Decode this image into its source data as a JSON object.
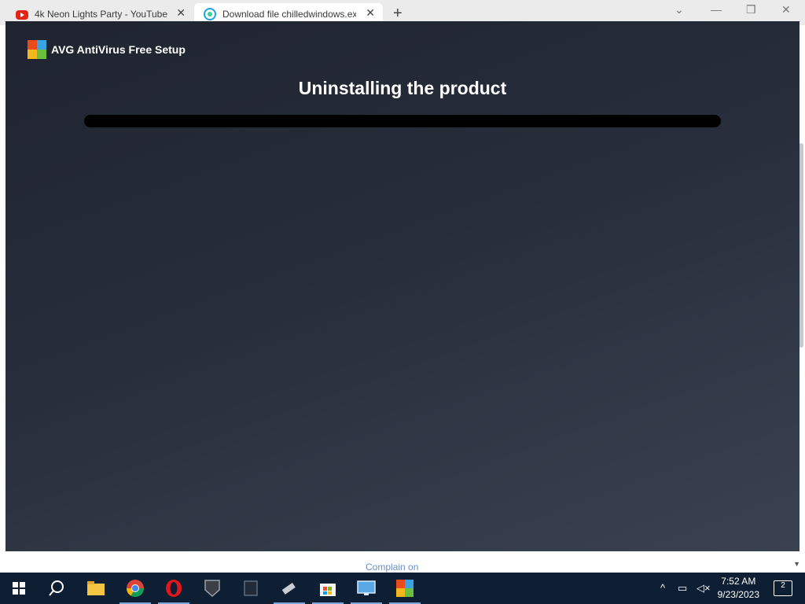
{
  "browser": {
    "tabs": [
      {
        "title": "4k Neon Lights Party - YouTube",
        "icon": "youtube-icon",
        "active": false
      },
      {
        "title": "Download file chilledwindows.exe",
        "icon": "site-icon",
        "active": true
      }
    ],
    "new_tab": "+",
    "close_glyph": "✕"
  },
  "installer": {
    "app_name": "AVG AntiVirus Free Setup",
    "heading": "Uninstalling the product",
    "progress": 0
  },
  "page": {
    "footer_link": "Complain on"
  },
  "taskbar": {
    "apps": [
      "start-icon",
      "search-icon",
      "file-explorer-icon",
      "chrome-icon",
      "opera-icon",
      "world-of-tanks-icon",
      "app-icon",
      "usb-drive-icon",
      "store-icon",
      "control-panel-icon",
      "avg-icon"
    ],
    "time": "7:52 AM",
    "date": "9/23/2023",
    "notifications": "2"
  },
  "colors": {
    "accent": "#4a9f3b",
    "taskbar": "#0f1f33"
  }
}
